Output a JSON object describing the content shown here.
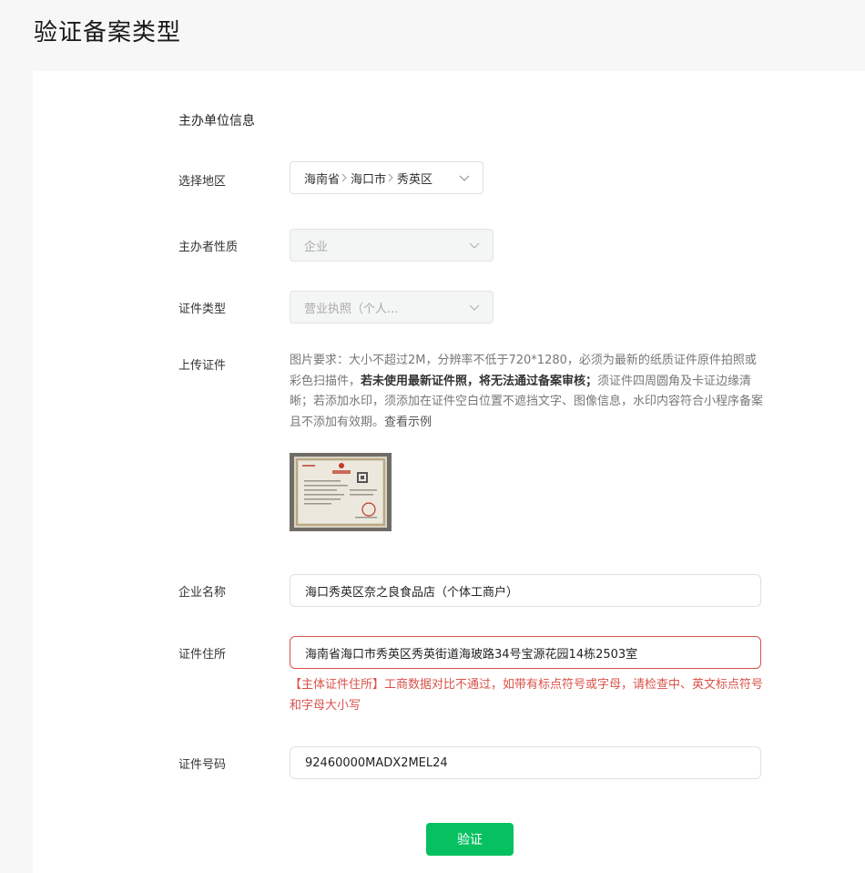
{
  "page_title": "验证备案类型",
  "section_title": "主办单位信息",
  "fields": {
    "region": {
      "label": "选择地区",
      "province": "海南省",
      "city": "海口市",
      "district": "秀英区"
    },
    "organizer_nature": {
      "label": "主办者性质",
      "value": "企业"
    },
    "cert_type": {
      "label": "证件类型",
      "value": "营业执照（个人..."
    },
    "upload": {
      "label": "上传证件",
      "desc_part1": "图片要求：大小不超过2M，分辨率不低于720*1280，必须为最新的纸质证件原件拍照或彩色扫描件，",
      "desc_bold": "若未使用最新证件照，将无法通过备案审核；",
      "desc_part2": "须证件四周圆角及卡证边缘清晰；若添加水印，须添加在证件空白位置不遮挡文字、图像信息，水印内容符合小程序备案且不添加有效期。",
      "example_link": "查看示例"
    },
    "company_name": {
      "label": "企业名称",
      "value": "海口秀英区奈之良食品店（个体工商户）"
    },
    "cert_address": {
      "label": "证件住所",
      "value": "海南省海口市秀英区秀英街道海玻路34号宝源花园14栋2503室",
      "error": "【主体证件住所】工商数据对比不通过，如带有标点符号或字母，请检查中、英文标点符号和字母大小写"
    },
    "cert_number": {
      "label": "证件号码",
      "value": "92460000MADX2MEL24"
    }
  },
  "submit_label": "验证",
  "colors": {
    "accent": "#07c160",
    "error": "#d9524a",
    "background": "#f7f7f7"
  }
}
